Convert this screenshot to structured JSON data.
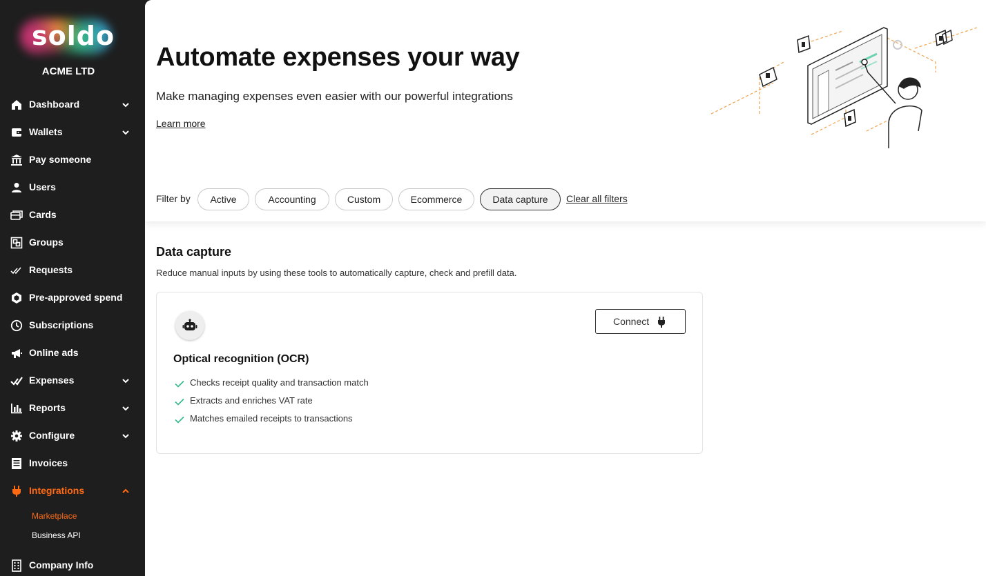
{
  "brand": {
    "logo_text": "soldo",
    "company": "ACME LTD",
    "accent": "#ff6a13",
    "check_color": "#2fb98a"
  },
  "sidebar": {
    "items": [
      {
        "label": "Dashboard",
        "icon": "home-icon",
        "expandable": true
      },
      {
        "label": "Wallets",
        "icon": "wallet-icon",
        "expandable": true
      },
      {
        "label": "Pay someone",
        "icon": "bank-icon",
        "expandable": false
      },
      {
        "label": "Users",
        "icon": "user-icon",
        "expandable": false
      },
      {
        "label": "Cards",
        "icon": "cards-icon",
        "expandable": false
      },
      {
        "label": "Groups",
        "icon": "groups-icon",
        "expandable": false
      },
      {
        "label": "Requests",
        "icon": "double-check-icon",
        "expandable": false
      },
      {
        "label": "Pre-approved spend",
        "icon": "hexagon-icon",
        "expandable": false
      },
      {
        "label": "Subscriptions",
        "icon": "clock-icon",
        "expandable": false
      },
      {
        "label": "Online ads",
        "icon": "megaphone-icon",
        "expandable": false
      },
      {
        "label": "Expenses",
        "icon": "expenses-check-icon",
        "expandable": true
      },
      {
        "label": "Reports",
        "icon": "bar-chart-icon",
        "expandable": true
      },
      {
        "label": "Configure",
        "icon": "gear-icon",
        "expandable": true
      },
      {
        "label": "Invoices",
        "icon": "invoice-icon",
        "expandable": false
      },
      {
        "label": "Integrations",
        "icon": "plug-icon",
        "expandable": true,
        "expanded": true,
        "active": true
      },
      {
        "label": "Company Info",
        "icon": "building-icon",
        "expandable": false
      }
    ],
    "integrations_sub": [
      {
        "label": "Marketplace",
        "active": true
      },
      {
        "label": "Business API",
        "active": false
      }
    ]
  },
  "hero": {
    "title": "Automate expenses your way",
    "subtitle": "Make managing expenses even easier with our powerful integrations",
    "learn_more": "Learn more"
  },
  "filters": {
    "label": "Filter by",
    "chips": [
      {
        "label": "Active",
        "selected": false
      },
      {
        "label": "Accounting",
        "selected": false
      },
      {
        "label": "Custom",
        "selected": false
      },
      {
        "label": "Ecommerce",
        "selected": false
      },
      {
        "label": "Data capture",
        "selected": true
      }
    ],
    "clear_label": "Clear all filters"
  },
  "section": {
    "title": "Data capture",
    "description": "Reduce manual inputs by using these tools to automatically capture, check and prefill data."
  },
  "integration_card": {
    "icon": "robot-icon",
    "title": "Optical recognition (OCR)",
    "connect_label": "Connect",
    "connect_icon": "plug-icon",
    "features": [
      "Checks receipt quality and transaction match",
      "Extracts and enriches VAT rate",
      "Matches emailed receipts to transactions"
    ]
  }
}
